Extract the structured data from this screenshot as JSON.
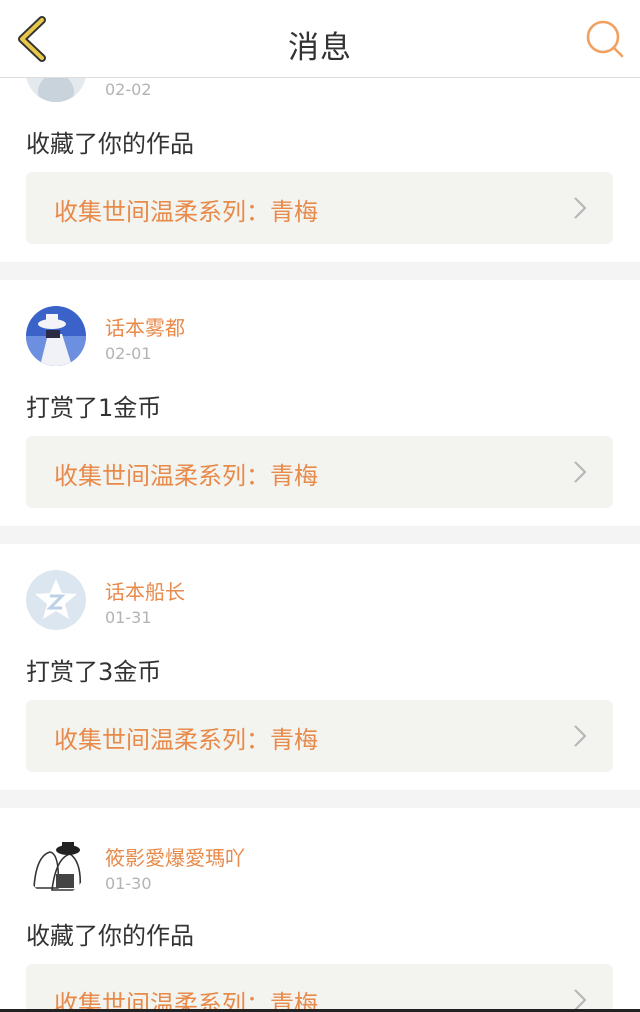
{
  "header": {
    "title": "消息",
    "back_icon": "chevron-left-icon",
    "search_icon": "search-icon",
    "accent_color": "#e8c84a",
    "search_color": "#f0a060"
  },
  "messages": [
    {
      "username": "",
      "date": "02-02",
      "action": "收藏了你的作品",
      "work_title": "收集世间温柔系列：青梅"
    },
    {
      "username": "话本雾都",
      "date": "02-01",
      "action": "打赏了1金币",
      "work_title": "收集世间温柔系列：青梅"
    },
    {
      "username": "话本船长",
      "date": "01-31",
      "action": "打赏了3金币",
      "work_title": "收集世间温柔系列：青梅"
    },
    {
      "username": "筱影愛爆愛瑪吖",
      "date": "01-30",
      "action": "收藏了你的作品",
      "work_title": "收集世间温柔系列：青梅"
    }
  ]
}
